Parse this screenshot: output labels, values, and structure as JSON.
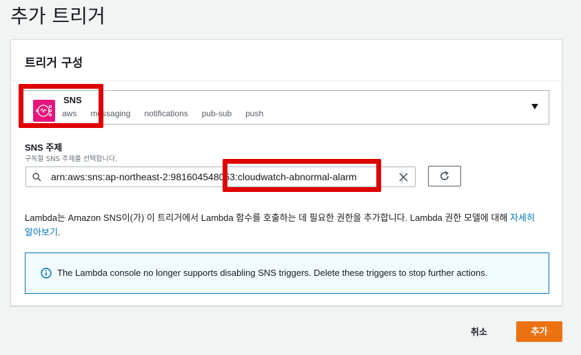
{
  "page": {
    "title": "추가 트리거"
  },
  "panel": {
    "title": "트리거 구성"
  },
  "trigger": {
    "service_name": "SNS",
    "service_icon": "sns-icon",
    "tags": [
      "aws",
      "messaging",
      "notifications",
      "pub-sub",
      "push"
    ]
  },
  "topic_field": {
    "label": "SNS 주제",
    "description": "구독할 SNS 주제를 선택합니다.",
    "value": "arn:aws:sns:ap-northeast-2:981604548053:cloudwatch-abnormal-alarm"
  },
  "info": {
    "text": "Lambda는 Amazon SNS이(가) 이 트리거에서 Lambda 함수를 호출하는 데 필요한 권한을 추가합니다. Lambda 권한 모델에 대해 ",
    "link": "자세히 알아보기",
    "suffix": "."
  },
  "alert": {
    "text": "The Lambda console no longer supports disabling SNS triggers. Delete these triggers to stop further actions."
  },
  "footer": {
    "cancel_label": "취소",
    "add_label": "추가"
  },
  "colors": {
    "primary": "#ec7211",
    "link": "#0073bb",
    "sns_brand": "#e7157b",
    "highlight": "#e00000",
    "info_bg": "#f1faff"
  }
}
